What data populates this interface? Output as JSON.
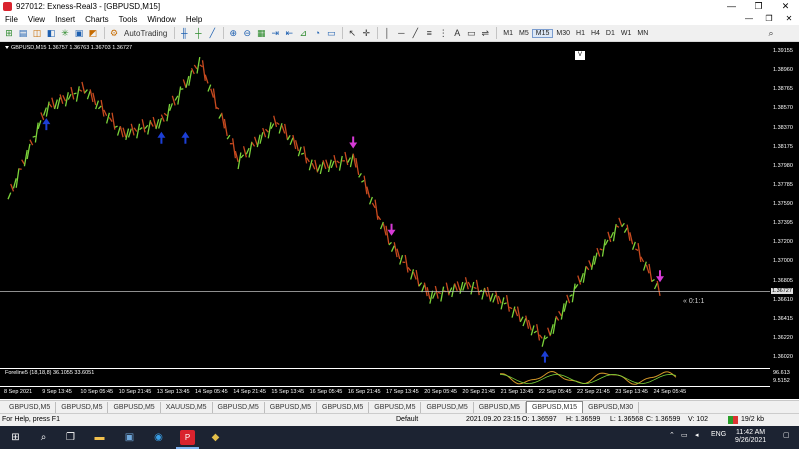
{
  "window": {
    "title": "927012: Exness-Real3 - [GBPUSD,M15]",
    "controls": [
      "—",
      "❐",
      "✕"
    ]
  },
  "menu": {
    "items": [
      "File",
      "View",
      "Insert",
      "Charts",
      "Tools",
      "Window",
      "Help"
    ],
    "mdi_controls": [
      "—",
      "❐",
      "✕"
    ]
  },
  "toolbar": {
    "autotrading_label": "AutoTrading",
    "timeframes": [
      "M1",
      "M5",
      "M15",
      "M30",
      "H1",
      "H4",
      "D1",
      "W1",
      "MN"
    ],
    "active_timeframe": "M15"
  },
  "chart": {
    "header": "GBPUSD,M15  1.36757 1.36763 1.36703 1.36727",
    "v_button": "V",
    "level_label": "« 0:1:1",
    "current_price": "1.36727",
    "price_labels": [
      "1.39155",
      "1.38960",
      "1.38765",
      "1.38570",
      "1.38370",
      "1.38175",
      "1.37980",
      "1.37785",
      "1.37590",
      "1.37395",
      "1.37200",
      "1.37000",
      "1.36805",
      "1.36610",
      "1.36415",
      "1.36220",
      "1.36020"
    ],
    "indicator_label": "Foreline5 (18,18,8) 36.1055 33.6051",
    "indicator_levels": [
      "96.613",
      "9.5152"
    ],
    "time_labels": [
      "8 Sep 2021",
      "9 Sep 13:45",
      "10 Sep 05:45",
      "10 Sep 21:45",
      "13 Sep 13:45",
      "14 Sep 05:45",
      "14 Sep 21:45",
      "15 Sep 13:45",
      "16 Sep 05:45",
      "16 Sep 21:45",
      "17 Sep 13:45",
      "20 Sep 05:45",
      "20 Sep 21:45",
      "21 Sep 13:45",
      "22 Sep 05:45",
      "22 Sep 21:45",
      "23 Sep 13:45",
      "24 Sep 05:45"
    ],
    "colors": {
      "background": "#000000",
      "bull": "#7bd33a",
      "bear": "#c84a1f",
      "signal_up": "#1c3fd6",
      "signal_down": "#d63ad6",
      "indicator": "#d89a2a"
    }
  },
  "chart_data": {
    "type": "line",
    "title": "GBPUSD,M15",
    "xlabel": "",
    "ylabel": "",
    "ylim": [
      1.3602,
      1.3922
    ],
    "x": [
      "8 Sep 2021",
      "9 Sep 13:45",
      "10 Sep 05:45",
      "10 Sep 21:45",
      "13 Sep 13:45",
      "14 Sep 05:45",
      "14 Sep 21:45",
      "15 Sep 13:45",
      "16 Sep 05:45",
      "16 Sep 21:45",
      "17 Sep 13:45",
      "20 Sep 05:45",
      "20 Sep 21:45",
      "21 Sep 13:45",
      "22 Sep 05:45",
      "22 Sep 21:45",
      "23 Sep 13:45",
      "24 Sep 05:45"
    ],
    "series": [
      {
        "values": [
          1.3768,
          1.3862,
          1.3882,
          1.3835,
          1.3848,
          1.391,
          1.3808,
          1.3848,
          1.38,
          1.381,
          1.372,
          1.3668,
          1.368,
          1.366,
          1.3622,
          1.369,
          1.3745,
          1.3672
        ]
      }
    ],
    "signals_up_x": [
      "9 Sep 13:45",
      "13 Sep 13:45",
      "13 Sep 13:45",
      "22 Sep 05:45"
    ],
    "signals_down_x": [
      "16 Sep 21:45",
      "17 Sep 13:45",
      "24 Sep 05:45"
    ],
    "level": 1.36727
  },
  "tabs": {
    "items": [
      "GBPUSD,M5",
      "GBPUSD,M5",
      "GBPUSD,M5",
      "XAUUSD,M5",
      "GBPUSD,M5",
      "GBPUSD,M5",
      "GBPUSD,M5",
      "GBPUSD,M5",
      "GBPUSD,M5",
      "GBPUSD,M5",
      "GBPUSD,M15",
      "GBPUSD,M30"
    ],
    "active": "GBPUSD,M15"
  },
  "status": {
    "help": "For Help, press F1",
    "profile": "Default",
    "datetime": "2021.09.20 23:15",
    "open": "O: 1.36597",
    "high": "H: 1.36599",
    "low": "L: 1.36568",
    "close": "C: 1.36599",
    "volume": "V: 102",
    "traffic": "19/2 kb"
  },
  "taskbar": {
    "language": "ENG",
    "time": "11:42 AM",
    "date": "9/26/2021"
  }
}
